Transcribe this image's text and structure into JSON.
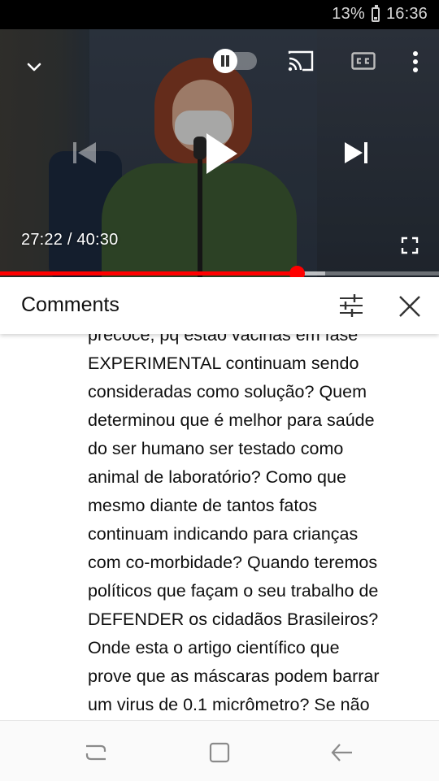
{
  "status_bar": {
    "battery": "13%",
    "time": "16:36"
  },
  "player": {
    "current_time": "27:22",
    "separator": "/",
    "duration": "40:30",
    "progress": 0.675,
    "buffered": 0.74,
    "accent_color": "#ff0000",
    "icons": [
      "chevron-down-icon",
      "autoplay-toggle",
      "cast-icon",
      "cc-icon",
      "more-vert-icon",
      "previous-icon",
      "play-icon",
      "next-icon",
      "fullscreen-icon"
    ]
  },
  "comments_panel": {
    "title": "Comments",
    "icons": [
      "filter-icon",
      "close-icon"
    ]
  },
  "comment": {
    "lines": [
      "precoce, pq estão vacinas em fase",
      "EXPERIMENTAL continuam sendo",
      "consideradas como solução? Quem",
      "determinou que é melhor para saúde",
      "do ser humano ser testado como",
      "animal de laboratório? Como que",
      "mesmo diante de tantos fatos",
      "continuam indicando para crianças",
      "com co-morbidade? Quando teremos",
      "políticos que façam o seu trabalho de",
      "DEFENDER os cidadãos Brasileiros?",
      "Onde esta o artigo científico que",
      "prove que as máscaras podem barrar",
      "um virus de 0.1 micrômetro? Se não"
    ]
  },
  "nav_bar": {
    "icons": [
      "recents-icon",
      "home-icon",
      "back-icon"
    ]
  }
}
